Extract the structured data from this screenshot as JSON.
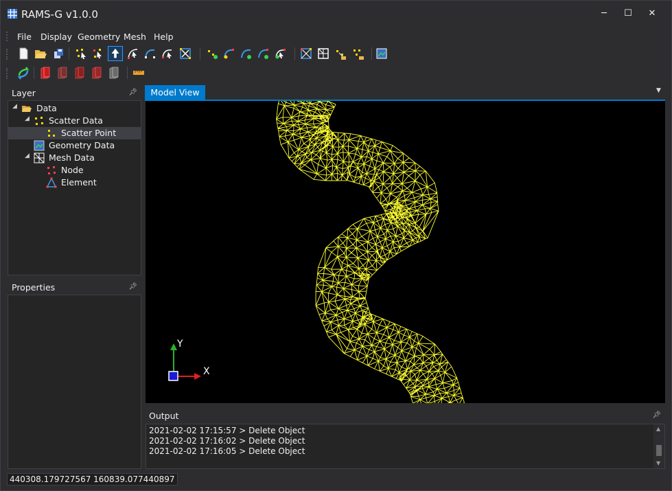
{
  "app": {
    "title": "RAMS-G v1.0.0",
    "icon": "grid-app-icon"
  },
  "window_controls": {
    "minimize": "─",
    "maximize": "☐",
    "close": "✕"
  },
  "menu": [
    "File",
    "Display",
    "Geometry",
    "Mesh",
    "Help"
  ],
  "toolbar1_icons": [
    "new-file-icon",
    "open-folder-icon",
    "save-icon",
    "scatter-add-icon",
    "scatter-select-icon",
    "select-arrow-icon",
    "vertex-select-icon",
    "arc-create-icon",
    "arc-select-icon",
    "delete-icon",
    "node-add-icon",
    "arc-node-icon",
    "arc-split-icon",
    "arc-merge-icon",
    "vertex-edit-icon",
    "mesh-generate-icon",
    "mesh-grid-icon",
    "mesh-quality-icon",
    "mesh-refine-icon",
    "geometry-view-icon"
  ],
  "toolbar2_icons": [
    "refresh-icon",
    "color-red-icon",
    "color-red2-icon",
    "color-red3-icon",
    "color-red4-icon",
    "color-grey-icon",
    "ruler-icon"
  ],
  "layer_panel": {
    "title": "Layer",
    "tree": [
      {
        "label": "Data",
        "icon": "folder-open-icon"
      },
      {
        "label": "Scatter Data",
        "icon": "scatter-data-icon"
      },
      {
        "label": "Scatter Point",
        "icon": "scatter-point-icon"
      },
      {
        "label": "Geometry Data",
        "icon": "geometry-data-icon"
      },
      {
        "label": "Mesh Data",
        "icon": "mesh-data-icon"
      },
      {
        "label": "Node",
        "icon": "node-icon"
      },
      {
        "label": "Element",
        "icon": "element-icon"
      }
    ]
  },
  "properties_panel": {
    "title": "Properties"
  },
  "model_view": {
    "tab": "Model View",
    "axis_x": "X",
    "axis_y": "Y",
    "mesh_color": "#ffff33"
  },
  "output_panel": {
    "title": "Output",
    "lines": [
      "2021-02-02 17:15:57 > Delete Object",
      "2021-02-02 17:16:02 > Delete Object",
      "2021-02-02 17:16:05 > Delete Object"
    ]
  },
  "status": {
    "coordinates": "440308.179727567 160839.077440897"
  },
  "colors": {
    "accent": "#007acc",
    "background": "#2d2d30",
    "panel": "#252526"
  }
}
